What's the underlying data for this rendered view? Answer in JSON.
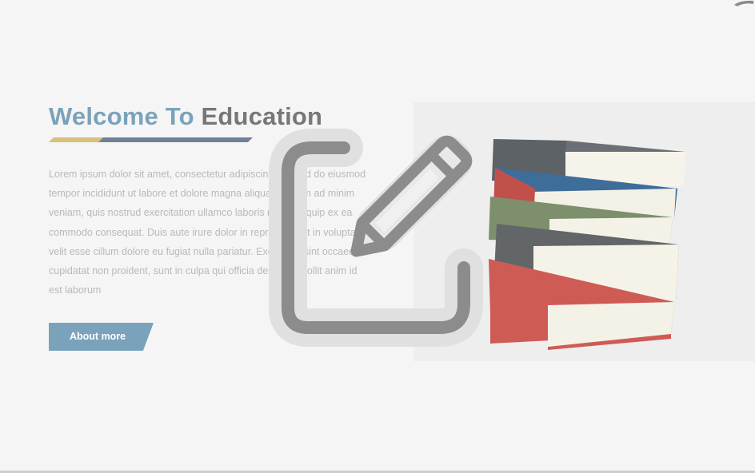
{
  "hero": {
    "title_part1": "Welcome To",
    "title_part2": "Education",
    "paragraph": "Lorem ipsum dolor sit amet, consectetur adipiscing elit, sed do eiusmod tempor incididunt ut labore et dolore magna aliqua. Ut enim ad minim veniam, quis nostrud exercitation ullamco laboris nisi ut aliquip ex ea commodo consequat. Duis aute irure dolor in reprehenderit in voluptate velit esse cillum dolore eu fugiat nulla pariatur. Excepteur sint occaecat cupidatat non proident, sunt in culpa qui officia deserunt mollit anim id est laborum",
    "button_label": "About more",
    "image_icon": "books-stack-image"
  },
  "overlay": {
    "icon": "edit-pencil-icon"
  },
  "colors": {
    "accent": "#7aa3bb",
    "title_gray": "#777777",
    "underline_gold": "#d9c07a",
    "underline_slate": "#6f7f95",
    "background": "#f5f5f5"
  }
}
